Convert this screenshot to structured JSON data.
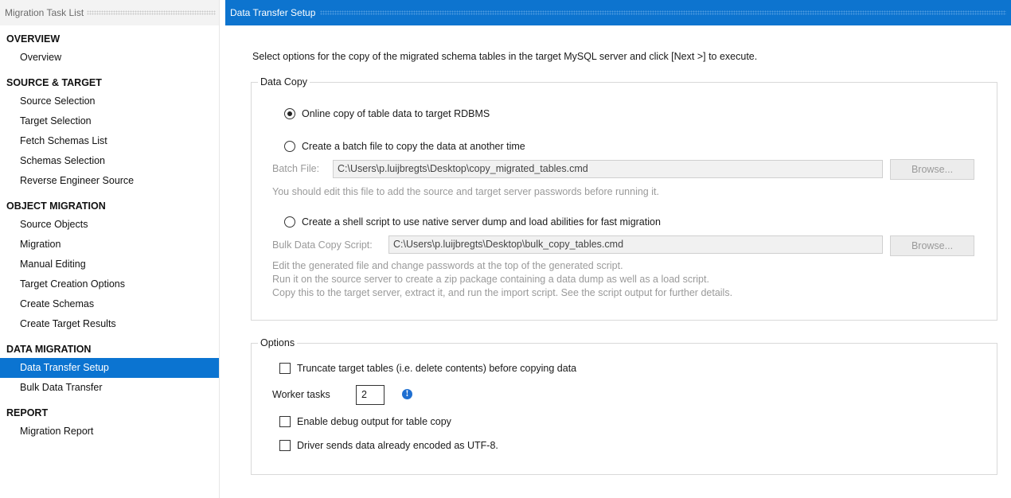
{
  "sidebar": {
    "title": "Migration Task List",
    "sections": {
      "overview": {
        "title": "OVERVIEW",
        "items": [
          "Overview"
        ]
      },
      "source_target": {
        "title": "SOURCE & TARGET",
        "items": [
          "Source Selection",
          "Target Selection",
          "Fetch Schemas List",
          "Schemas Selection",
          "Reverse Engineer Source"
        ]
      },
      "object_migration": {
        "title": "OBJECT MIGRATION",
        "items": [
          "Source Objects",
          "Migration",
          "Manual Editing",
          "Target Creation Options",
          "Create Schemas",
          "Create Target Results"
        ]
      },
      "data_migration": {
        "title": "DATA MIGRATION",
        "items": [
          "Data Transfer Setup",
          "Bulk Data Transfer"
        ]
      },
      "report": {
        "title": "REPORT",
        "items": [
          "Migration Report"
        ]
      }
    },
    "active_item": "Data Transfer Setup"
  },
  "main": {
    "title": "Data Transfer Setup",
    "intro": "Select options for the copy of the migrated schema tables in the target MySQL server and click [Next >] to execute.",
    "data_copy": {
      "label": "Data Copy",
      "online_copy_label": "Online copy of table data to target RDBMS",
      "batch_label": "Create a batch file to copy the data at another time",
      "batch_file_label": "Batch File:",
      "batch_file_value": "C:\\Users\\p.luijbregts\\Desktop\\copy_migrated_tables.cmd",
      "browse_label": "Browse...",
      "batch_hint": "You should edit this file to add the source and target server passwords before running it.",
      "shell_label": "Create a shell script to use native server dump and load abilities for fast migration",
      "bulk_script_label": "Bulk Data Copy Script:",
      "bulk_script_value": "C:\\Users\\p.luijbregts\\Desktop\\bulk_copy_tables.cmd",
      "shell_hint_1": "Edit the generated file and change passwords at the top of the generated script.",
      "shell_hint_2": "Run it on the source server to create a zip package containing a data dump as well as a load script.",
      "shell_hint_3": "Copy this to the target server, extract it, and run the import script. See the script output for further details.",
      "selected": "online"
    },
    "options": {
      "label": "Options",
      "truncate_label": "Truncate target tables (i.e. delete contents) before copying data",
      "worker_tasks_label": "Worker tasks",
      "worker_tasks_value": "2",
      "debug_label": "Enable debug output for table copy",
      "utf8_label": "Driver sends data already encoded as UTF-8."
    }
  },
  "icons": {
    "info": "info-icon"
  },
  "colors": {
    "accent": "#0d74cf",
    "active_item": "#0b74d1"
  }
}
